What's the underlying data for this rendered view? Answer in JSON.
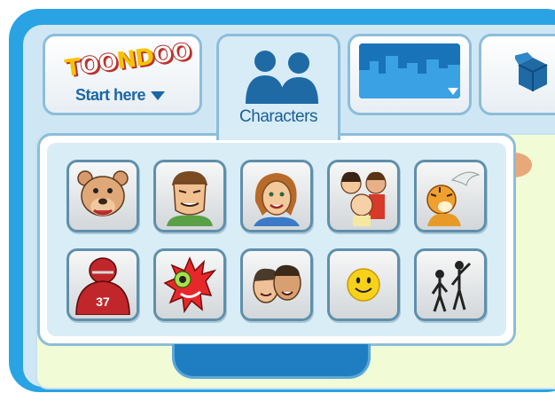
{
  "logo": {
    "letters": [
      "T",
      "O",
      "O",
      "N",
      "D",
      "O",
      "O"
    ]
  },
  "tabs": {
    "start": {
      "label": "Start here"
    },
    "characters": {
      "label": "Characters"
    },
    "scenes": {
      "icon": "city-skyline-icon"
    },
    "props": {
      "icon": "box-icon"
    }
  },
  "character_categories": [
    {
      "icon": "bear-character-icon"
    },
    {
      "icon": "muscle-man-character-icon"
    },
    {
      "icon": "woman-character-icon"
    },
    {
      "icon": "family-character-icon"
    },
    {
      "icon": "tiger-bird-character-icon"
    },
    {
      "icon": "football-player-character-icon",
      "text": "37"
    },
    {
      "icon": "red-monster-character-icon"
    },
    {
      "icon": "celebrity-faces-character-icon"
    },
    {
      "icon": "smiley-face-icon"
    },
    {
      "icon": "stick-figures-character-icon"
    }
  ],
  "colors": {
    "frame": "#29a3e3",
    "panel": "#d9edf7",
    "tab_text": "#1b5e96",
    "canvas": "#f1fbd6"
  }
}
